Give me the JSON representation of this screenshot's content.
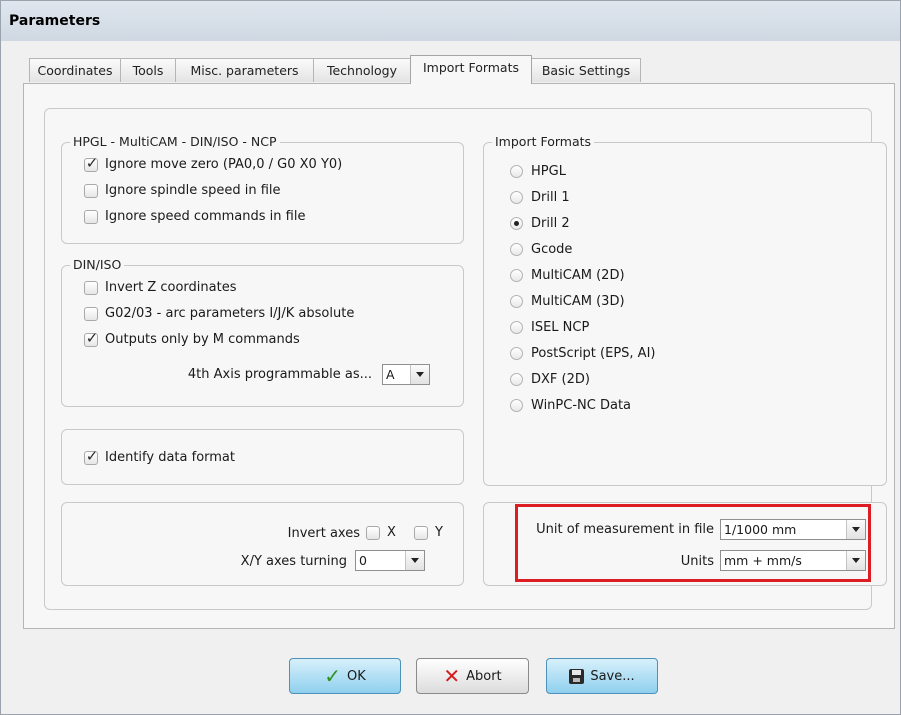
{
  "window": {
    "title": "Parameters"
  },
  "tabs": [
    {
      "label": "Coordinates"
    },
    {
      "label": "Tools"
    },
    {
      "label": "Misc. parameters"
    },
    {
      "label": "Technology"
    },
    {
      "label": "Import Formats"
    },
    {
      "label": "Basic Settings"
    }
  ],
  "hpgl_group": {
    "legend": "HPGL - MultiCAM - DIN/ISO - NCP",
    "options": [
      {
        "label": "Ignore move zero (PA0,0 / G0 X0 Y0)",
        "checked": true
      },
      {
        "label": "Ignore spindle speed in file",
        "checked": false
      },
      {
        "label": "Ignore speed commands in file",
        "checked": false
      }
    ]
  },
  "din_group": {
    "legend": "DIN/ISO",
    "options": [
      {
        "label": "Invert Z coordinates",
        "checked": false
      },
      {
        "label": "G02/03 - arc parameters I/J/K absolute",
        "checked": false
      },
      {
        "label": "Outputs only by M commands",
        "checked": true
      }
    ],
    "axis4_label": "4th Axis programmable as...",
    "axis4_value": "A"
  },
  "identify": {
    "label": "Identify data format",
    "checked": true
  },
  "invert": {
    "label": "Invert axes",
    "x_label": "X",
    "y_label": "Y",
    "turning_label": "X/Y axes turning",
    "turning_value": "0"
  },
  "import_formats": {
    "legend": "Import Formats",
    "options": [
      {
        "label": "HPGL",
        "selected": false
      },
      {
        "label": "Drill 1",
        "selected": false
      },
      {
        "label": "Drill 2",
        "selected": true
      },
      {
        "label": "Gcode",
        "selected": false
      },
      {
        "label": "MultiCAM (2D)",
        "selected": false
      },
      {
        "label": "MultiCAM (3D)",
        "selected": false
      },
      {
        "label": "ISEL NCP",
        "selected": false
      },
      {
        "label": "PostScript (EPS, AI)",
        "selected": false
      },
      {
        "label": "DXF (2D)",
        "selected": false
      },
      {
        "label": "WinPC-NC Data",
        "selected": false
      }
    ]
  },
  "units": {
    "measurement_label": "Unit of measurement in file",
    "measurement_value": "1/1000 mm",
    "units_label": "Units",
    "units_value": "mm + mm/s"
  },
  "buttons": {
    "ok": "OK",
    "abort": "Abort",
    "save": "Save..."
  },
  "colors": {
    "highlight": "#dc1e24",
    "ok_icon": "#2f8f1f",
    "abort_icon": "#d41c1c"
  }
}
